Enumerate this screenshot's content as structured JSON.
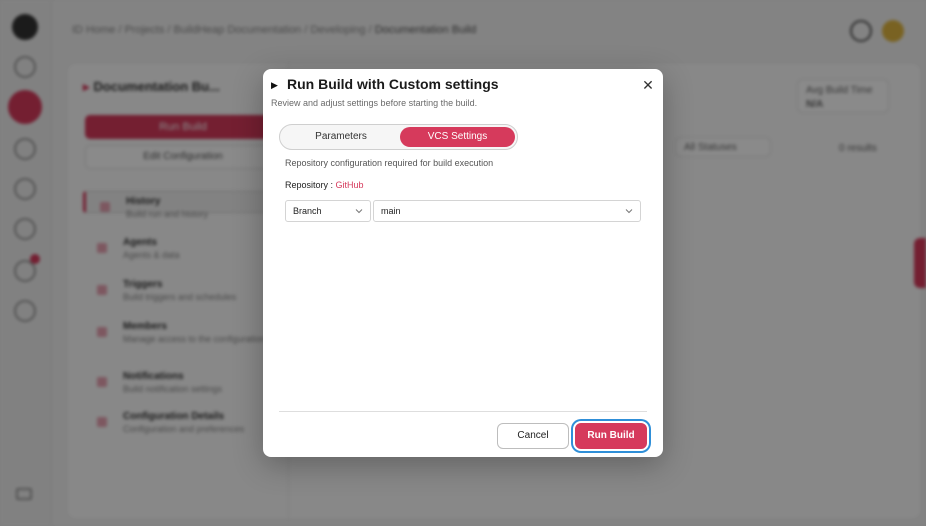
{
  "background": {
    "breadcrumb": [
      "ID Home",
      "Projects",
      "BuildHeap Documentation",
      "Developing",
      "Documentation Build"
    ],
    "page_title": "Documentation Bu...",
    "run_build_label": "Run Build",
    "edit_config_label": "Edit Configuration",
    "nav": [
      {
        "title": "History",
        "subtitle": "Build run and history"
      },
      {
        "title": "Agents",
        "subtitle": "Agents & data"
      },
      {
        "title": "Triggers",
        "subtitle": "Build triggers and schedules"
      },
      {
        "title": "Members",
        "subtitle": "Manage access to the configuration"
      },
      {
        "title": "Notifications",
        "subtitle": "Build notification settings"
      },
      {
        "title": "Configuration Details",
        "subtitle": "Configuration and preferences"
      }
    ],
    "filter_label": "All Statuses",
    "count_label": "0 results",
    "avg_label": "Avg Build Time",
    "avg_value": "N/A"
  },
  "modal": {
    "title": "Run Build with Custom settings",
    "subtitle": "Review and adjust settings before starting the build.",
    "tabs": [
      {
        "label": "Parameters",
        "active": false
      },
      {
        "label": "VCS Settings",
        "active": true
      }
    ],
    "description": "Repository configuration required for build execution",
    "repository_label": "Repository : ",
    "repository_value": "GitHub",
    "ref_type": "Branch",
    "branch": "main",
    "cancel_label": "Cancel",
    "run_label": "Run Build"
  },
  "colors": {
    "accent": "#d63a5c",
    "focus_ring": "#2f8fd8"
  },
  "icons": {
    "play": "play-icon",
    "close": "close-icon",
    "chevron": "chevron-down-icon"
  }
}
